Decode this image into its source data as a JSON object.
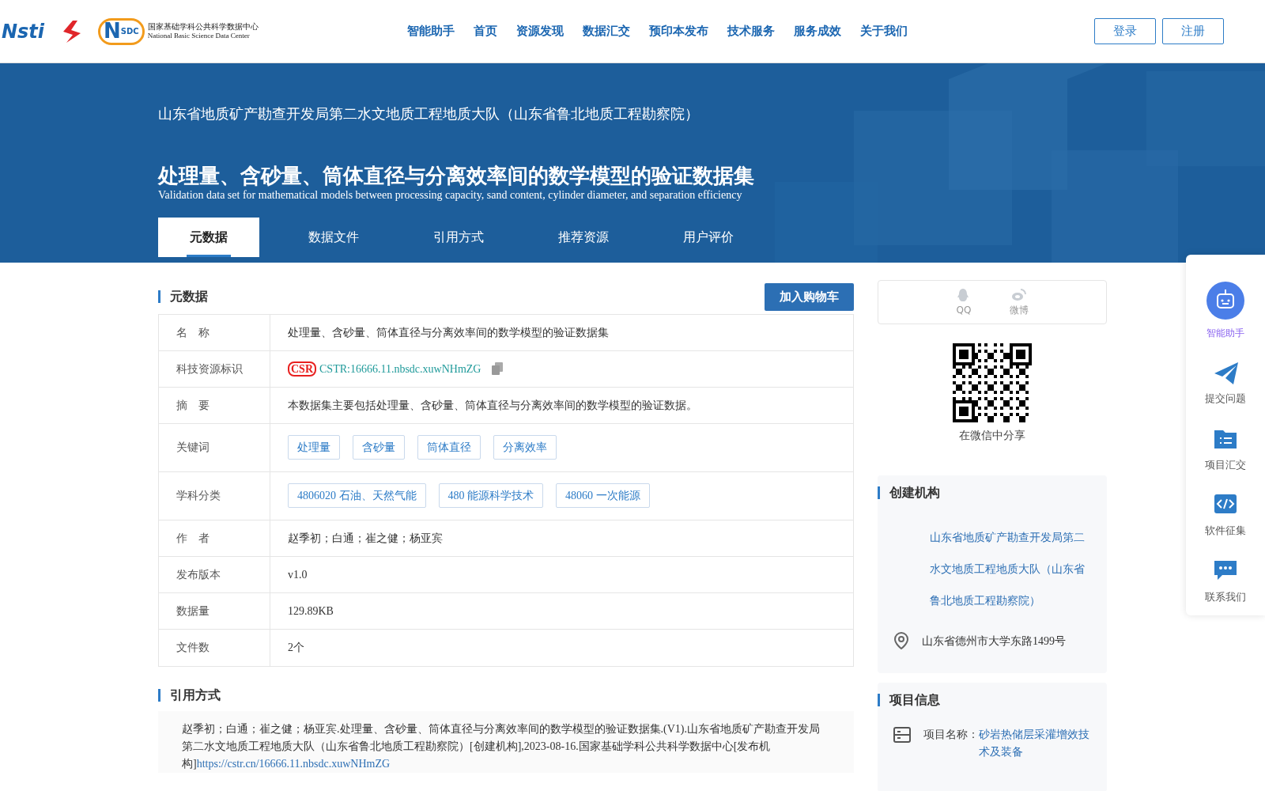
{
  "header": {
    "logo_text": "Nsti",
    "nsdc_logo": {
      "letter": "N",
      "badge": "SDC",
      "name": "国家基础学科公共科学数据中心",
      "name_en": "National Basic Science Data Center"
    },
    "nav": [
      "智能助手",
      "首页",
      "资源发现",
      "数据汇交",
      "预印本发布",
      "技术服务",
      "服务成效",
      "关于我们"
    ],
    "auth_buttons": [
      "登录",
      "注册"
    ]
  },
  "banner": {
    "organization": "山东省地质矿产勘查开发局第二水文地质工程地质大队（山东省鲁北地质工程勘察院）",
    "title": "处理量、含砂量、筒体直径与分离效率间的数学模型的验证数据集",
    "title_en": "Validation data set for mathematical models between processing capacity, sand content, cylinder diameter, and separation efficiency"
  },
  "tabs": [
    {
      "label": "元数据",
      "selected": true
    },
    {
      "label": "数据文件",
      "selected": false
    },
    {
      "label": "引用方式",
      "selected": false
    },
    {
      "label": "推荐资源",
      "selected": false
    },
    {
      "label": "用户评价",
      "selected": false
    }
  ],
  "metadata": {
    "heading": "元数据",
    "cart_button": "加入购物车",
    "rows": [
      {
        "label": "名　称",
        "kind": "text",
        "value": "处理量、含砂量、筒体直径与分离效率间的数学模型的验证数据集"
      },
      {
        "label": "科技资源标识",
        "kind": "cstr",
        "logo": "CSR",
        "value": "CSTR:16666.11.nbsdc.xuwNHmZG"
      },
      {
        "label": "摘　要",
        "kind": "text",
        "value": "本数据集主要包括处理量、含砂量、筒体直径与分离效率间的数学模型的验证数据。"
      },
      {
        "label": "关键词",
        "kind": "tags",
        "tags": [
          "处理量",
          "含砂量",
          "筒体直径",
          "分离效率"
        ]
      },
      {
        "label": "学科分类",
        "kind": "tags",
        "tags": [
          "4806020 石油、天然气能",
          "480 能源科学技术",
          "48060 一次能源"
        ]
      },
      {
        "label": "作　者",
        "kind": "text",
        "value": "赵季初；白通；崔之健；杨亚宾"
      },
      {
        "label": "发布版本",
        "kind": "text",
        "value": "v1.0"
      },
      {
        "label": "数据量",
        "kind": "text",
        "value": "129.89KB"
      },
      {
        "label": "文件数",
        "kind": "text",
        "value": "2个"
      }
    ]
  },
  "citation": {
    "heading": "引用方式",
    "text": "赵季初；白通；崔之健；杨亚宾.处理量、含砂量、筒体直径与分离效率间的数学模型的验证数据集.(V1).山东省地质矿产勘查开发局第二水文地质工程地质大队（山东省鲁北地质工程勘察院）[创建机构],2023-08-16.国家基础学科公共科学数据中心[发布机构]",
    "link": "https://cstr.cn/16666.11.nbsdc.xuwNHmZG"
  },
  "share": {
    "items": [
      {
        "kind": "qq",
        "label": "QQ"
      },
      {
        "kind": "weibo",
        "label": "微博"
      }
    ],
    "qr_caption": "在微信中分享"
  },
  "creator": {
    "heading": "创建机构",
    "name": "山东省地质矿产勘查开发局第二水文地质工程地质大队（山东省鲁北地质工程勘察院）",
    "address": "山东省德州市大学东路1499号"
  },
  "project": {
    "heading": "项目信息",
    "label": "项目名称：",
    "name": "砂岩热储层采灌增效技术及装备"
  },
  "side_tools": [
    {
      "kind": "robot",
      "label": "智能助手"
    },
    {
      "kind": "send",
      "label": "提交问题"
    },
    {
      "kind": "folder",
      "label": "项目汇交"
    },
    {
      "kind": "code",
      "label": "软件征集"
    },
    {
      "kind": "chat",
      "label": "联系我们"
    }
  ]
}
